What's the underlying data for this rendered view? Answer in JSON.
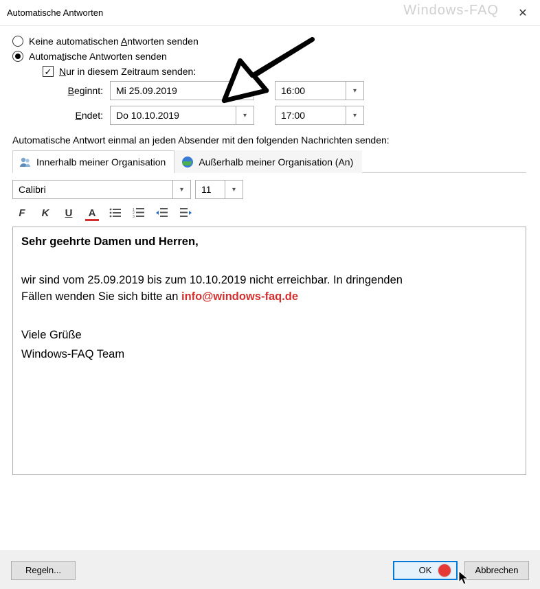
{
  "window": {
    "title": "Automatische Antworten",
    "watermark": "Windows-FAQ"
  },
  "options": {
    "radio_no_send": "Keine automatischen Antworten senden",
    "radio_send": "Automatische Antworten senden",
    "check_timerange": "Nur in diesem Zeitraum senden:"
  },
  "dates": {
    "begin_label": "Beginnt:",
    "begin_date": "Mi 25.09.2019",
    "begin_time": "16:00",
    "end_label": "Endet:",
    "end_date": "Do 10.10.2019",
    "end_time": "17:00"
  },
  "section_label": "Automatische Antwort einmal an jeden Absender mit den folgenden Nachrichten senden:",
  "tabs": {
    "inside": "Innerhalb meiner Organisation",
    "outside": "Außerhalb meiner Organisation (An)"
  },
  "format": {
    "font": "Calibri",
    "size": "11"
  },
  "toolbar": {
    "bold": "F",
    "italic": "K",
    "underline": "U",
    "fontcolor": "A"
  },
  "message": {
    "greeting": "Sehr geehrte Damen und Herren,",
    "body1_a": "wir sind vom 25.09.2019 bis zum 10.10.2019 nicht erreichbar. In dringenden",
    "body1_b": "Fällen wenden Sie sich bitte an ",
    "email": "info@windows-faq.de",
    "signoff1": "Viele Grüße",
    "signoff2": "Windows-FAQ Team"
  },
  "buttons": {
    "rules": "Regeln...",
    "ok": "OK",
    "cancel": "Abbrechen"
  }
}
